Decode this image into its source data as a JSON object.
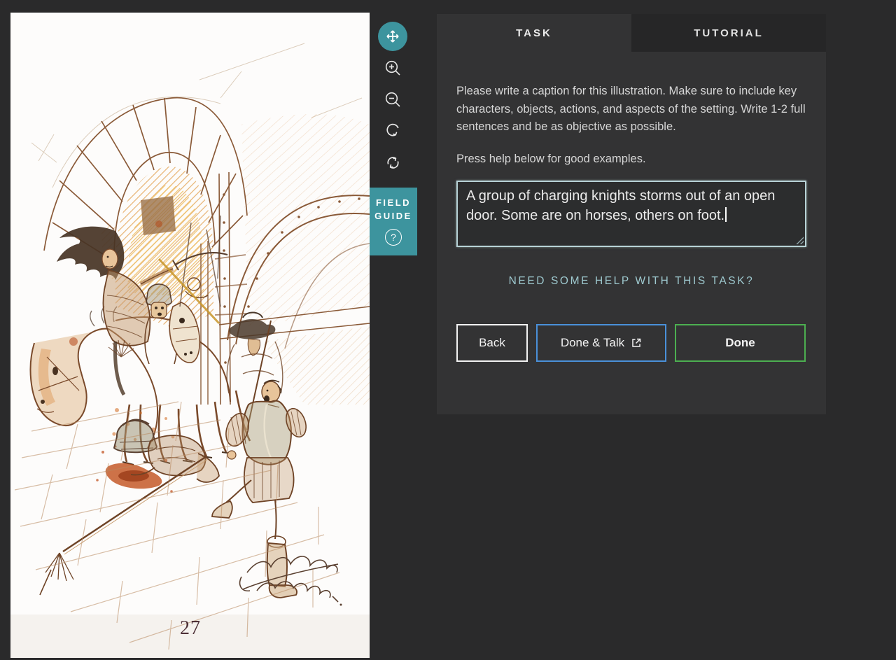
{
  "viewer": {
    "page_number": "27",
    "toolbar": {
      "field_guide": {
        "line1": "FIELD",
        "line2": "GUIDE",
        "help_mark": "?"
      }
    }
  },
  "panel": {
    "tabs": [
      {
        "label": "TASK",
        "active": true
      },
      {
        "label": "TUTORIAL",
        "active": false
      }
    ],
    "instructions_p1": "Please write a caption for this illustration. Make sure to include key characters, objects, actions, and aspects of the setting. Write 1-2 full sentences and be as objective as possible.",
    "instructions_p2": "Press help below for good examples.",
    "caption_input": {
      "value": "A group of charging knights storms out of an open door. Some are on horses, others on foot."
    },
    "help_link": "NEED SOME HELP WITH THIS TASK?",
    "buttons": {
      "back": "Back",
      "done_talk": "Done & Talk",
      "done": "Done"
    }
  },
  "colors": {
    "accent_teal": "#3d949e",
    "panel_bg": "#333334",
    "tab_inactive_bg": "#262627",
    "page_bg": "#2a2a2b",
    "textarea_border": "#b7d2d6",
    "help_link": "#9ec9cf",
    "button_blue": "#4a90d9",
    "button_green": "#4caf50"
  }
}
